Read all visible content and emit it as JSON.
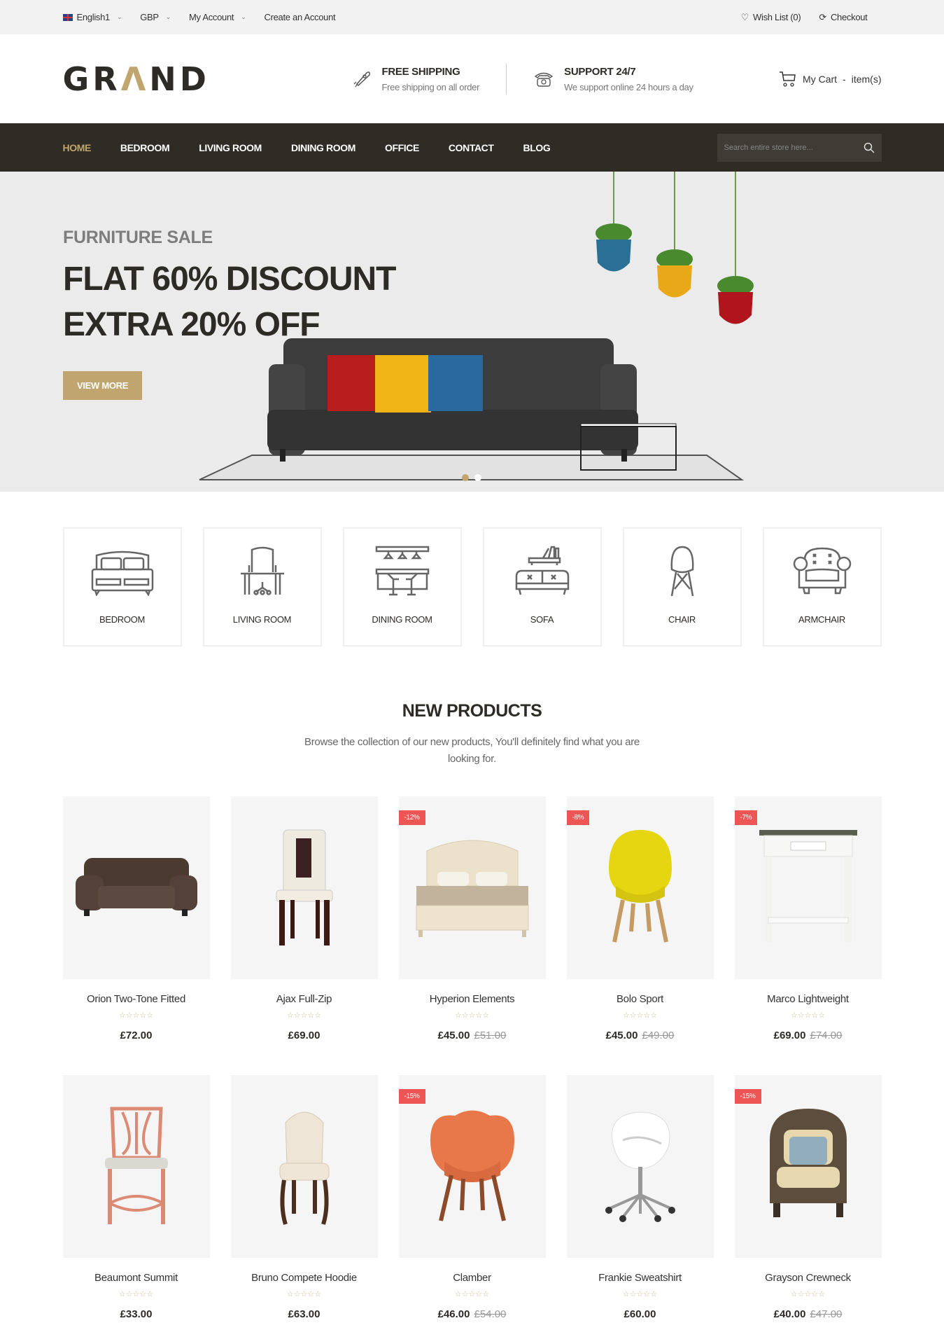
{
  "topbar": {
    "language": "English1",
    "currency": "GBP",
    "account": "My Account",
    "create_account": "Create an Account",
    "wishlist": "Wish List (0)",
    "checkout": "Checkout"
  },
  "header": {
    "logo_pre": "GR",
    "logo_accent": "Λ",
    "logo_post": "ND",
    "shipping_title": "FREE SHIPPING",
    "shipping_sub": "Free shipping on all order",
    "support_title": "SUPPORT 24/7",
    "support_sub": "We support online 24 hours a day",
    "cart_label": "My Cart",
    "cart_sep": "-",
    "cart_items": "item(s)"
  },
  "nav": {
    "items": [
      "HOME",
      "BEDROOM",
      "LIVING ROOM",
      "DINING ROOM",
      "OFFICE",
      "CONTACT",
      "BLOG"
    ],
    "search_placeholder": "Search entire store here..."
  },
  "hero": {
    "eyebrow": "FURNITURE SALE",
    "line1": "FLAT 60% DISCOUNT",
    "line2": "EXTRA 20% OFF",
    "button": "VIEW MORE",
    "active_slide": 1,
    "slide_count": 2
  },
  "categories": [
    "BEDROOM",
    "LIVING ROOM",
    "DINING ROOM",
    "SOFA",
    "CHAIR",
    "ARMCHAIR"
  ],
  "new_products": {
    "title": "NEW PRODUCTS",
    "subtitle": "Browse the collection of our new products, You'll definitely find what you are looking for.",
    "items": [
      {
        "name": "Orion Two-Tone Fitted",
        "price": "£72.00",
        "old": "",
        "badge": "",
        "stars": "☆☆☆☆☆",
        "img": "sofa"
      },
      {
        "name": "Ajax Full-Zip",
        "price": "£69.00",
        "old": "",
        "badge": "",
        "stars": "☆☆☆☆☆",
        "img": "dining-chair"
      },
      {
        "name": "Hyperion Elements",
        "price": "£45.00",
        "old": "£51.00",
        "badge": "-12%",
        "stars": "☆☆☆☆☆",
        "img": "bed"
      },
      {
        "name": "Bolo Sport",
        "price": "£45.00",
        "old": "£49.00",
        "badge": "-8%",
        "stars": "☆☆☆☆☆",
        "img": "yellow-chair"
      },
      {
        "name": "Marco Lightweight",
        "price": "£69.00",
        "old": "£74.00",
        "badge": "-7%",
        "stars": "☆☆☆☆☆",
        "img": "side-table"
      },
      {
        "name": "Beaumont Summit",
        "price": "£33.00",
        "old": "",
        "badge": "",
        "stars": "☆☆☆☆☆",
        "img": "pink-chair"
      },
      {
        "name": "Bruno Compete Hoodie",
        "price": "£63.00",
        "old": "",
        "badge": "",
        "stars": "☆☆☆☆☆",
        "img": "cream-chair"
      },
      {
        "name": "Clamber",
        "price": "£46.00",
        "old": "£54.00",
        "badge": "-15%",
        "stars": "☆☆☆☆☆",
        "img": "orange-chair"
      },
      {
        "name": "Frankie Sweatshirt",
        "price": "£60.00",
        "old": "",
        "badge": "",
        "stars": "☆☆☆☆☆",
        "img": "office-chair"
      },
      {
        "name": "Grayson Crewneck",
        "price": "£40.00",
        "old": "£47.00",
        "badge": "-15%",
        "stars": "☆☆☆☆☆",
        "img": "wicker-chair"
      }
    ]
  },
  "colors": {
    "accent": "#c1a56e",
    "nav_bg": "#2e2c25",
    "badge": "#ee5656",
    "hero_bg": "#ebebeb"
  }
}
